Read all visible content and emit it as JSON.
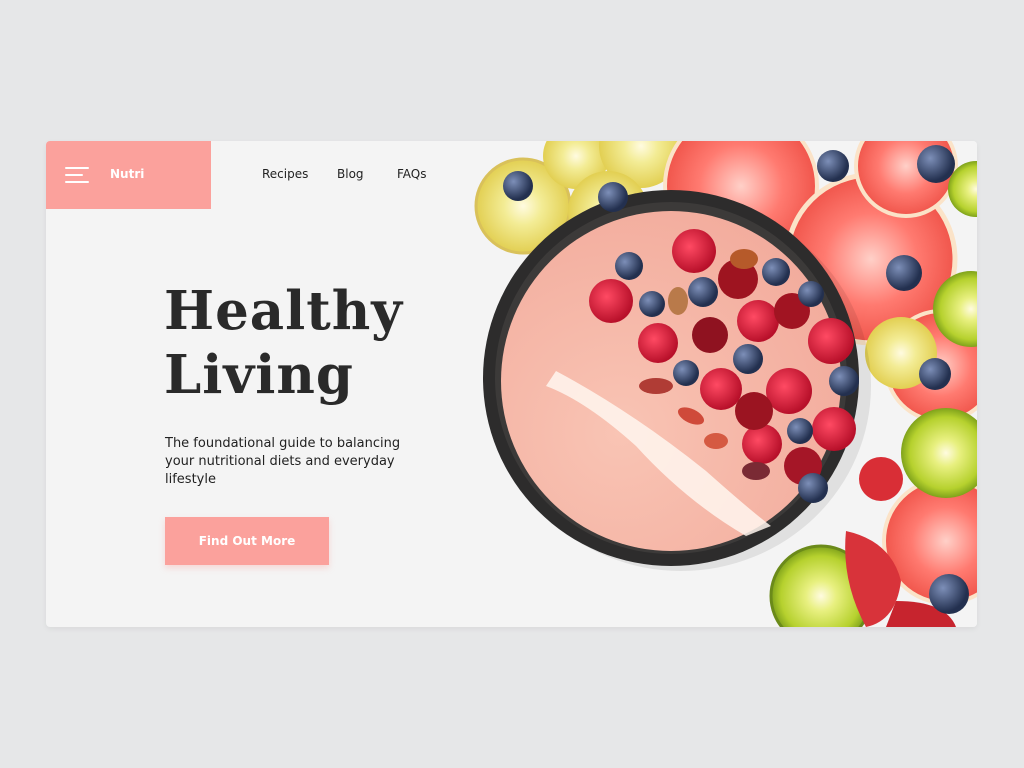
{
  "brand": {
    "name": "Nutri"
  },
  "nav": {
    "items": [
      "Recipes",
      "Blog",
      "FAQs"
    ]
  },
  "hero": {
    "title_line1": "Healthy",
    "title_line2": "Living",
    "subtitle": "The foundational guide to balancing your nutritional diets and everyday lifestyle",
    "cta_label": "Find Out More"
  },
  "colors": {
    "accent": "#fba19c",
    "background": "#e6e7e8",
    "card": "#f4f4f4",
    "text": "#2a2a2a"
  },
  "icons": [
    "hamburger-menu-icon"
  ]
}
